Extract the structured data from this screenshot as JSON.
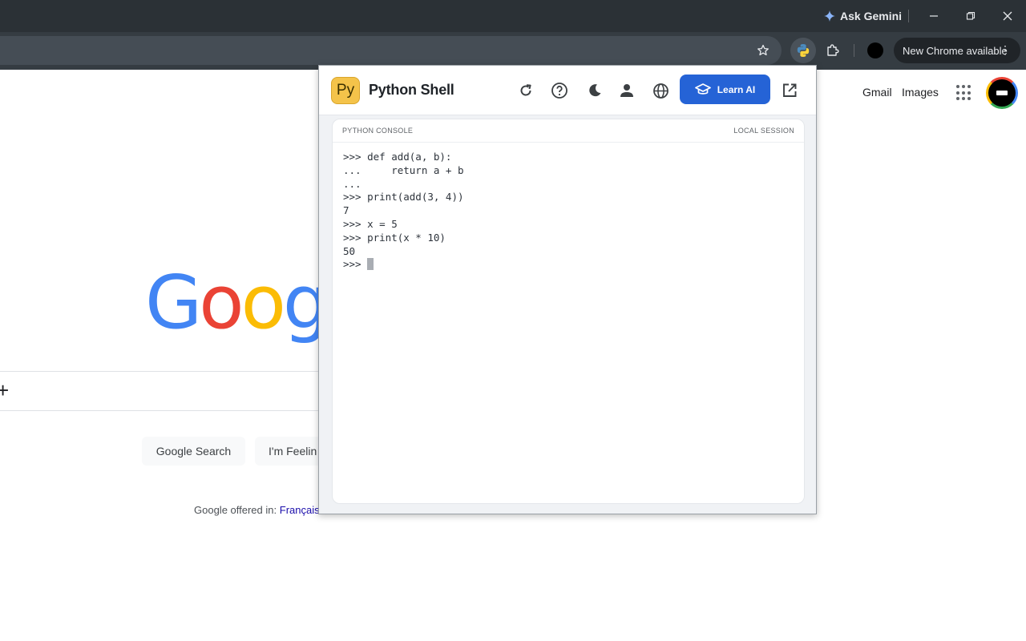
{
  "chrome": {
    "gemini_label": "Ask Gemini",
    "new_chrome_label": "New Chrome available",
    "colors": {
      "titlebar": "#2b3136",
      "toolbar": "#353c42"
    }
  },
  "google": {
    "logo_text": [
      "G",
      "o",
      "o",
      "g"
    ],
    "logo_colors": [
      "#4285f4",
      "#ea4335",
      "#fbbc05",
      "#4285f4"
    ],
    "gmail_label": "Gmail",
    "images_label": "Images",
    "search_button": "Google Search",
    "lucky_button": "I'm Feelin",
    "offered_prefix": "Google offered in:",
    "offered_language": "Français"
  },
  "popup": {
    "logo_text": "Py",
    "title": "Python Shell",
    "learn_button": "Learn AI",
    "console_label": "PYTHON CONSOLE",
    "session_label": "LOCAL SESSION",
    "lines": [
      ">>> def add(a, b):",
      "...     return a + b",
      "...",
      ">>> print(add(3, 4))",
      "7",
      ">>> x = 5",
      ">>> print(x * 10)",
      "50"
    ],
    "prompt": ">>> ",
    "accent_color": "#2563d6"
  }
}
